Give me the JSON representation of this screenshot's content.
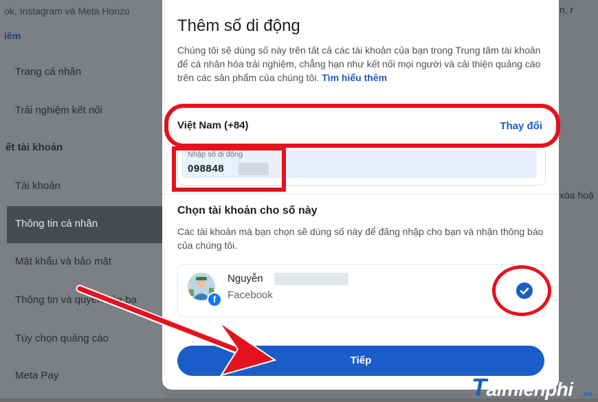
{
  "background": {
    "top_text": "ok, Instagram và Meta Horizo",
    "top_link": "iêm",
    "sidebar_items": [
      "Trang cá nhân",
      "Trải nghiệm kết nối"
    ],
    "section_label": "ết tài khoản",
    "sidebar_items_2": [
      "Tài khoản",
      "Thông tin cá nhân",
      "Mật khẩu và bảo mật",
      "Thông tin và quyền của bạ",
      "Tùy chọn quảng cáo",
      "Meta Pay"
    ],
    "right_text_1": "n, r",
    "right_text_2": "xóa hoặ"
  },
  "modal": {
    "title": "Thêm số di động",
    "description": "Chúng tôi sẽ dùng số này trên tất cả các tài khoản của bạn trong Trung tâm tài khoản để cá nhân hóa trải nghiệm, chẳng hạn như kết nối mọi người và cải thiện quảng cáo trên các sản phẩm của chúng tôi.",
    "learn_more": "Tìm hiểu thêm",
    "country": "Việt Nam (+84)",
    "change_link": "Thay đổi",
    "phone_placeholder": "Nhập số di động",
    "phone_value": "098848",
    "section_title": "Chọn tài khoản cho số này",
    "section_desc": "Các tài khoản mà bạn chọn sẽ dùng số này để đăng nhập cho bạn và nhận thông báo của chúng tôi.",
    "account": {
      "name": "Nguyễn",
      "platform": "Facebook",
      "badge": "f",
      "checked": true
    },
    "next_button": "Tiếp"
  },
  "watermark": {
    "main": "aimienphi",
    "initial": "T",
    "sub": ".vn"
  },
  "colors": {
    "accent": "#1a5dc8",
    "annotation": "#e3121d"
  }
}
